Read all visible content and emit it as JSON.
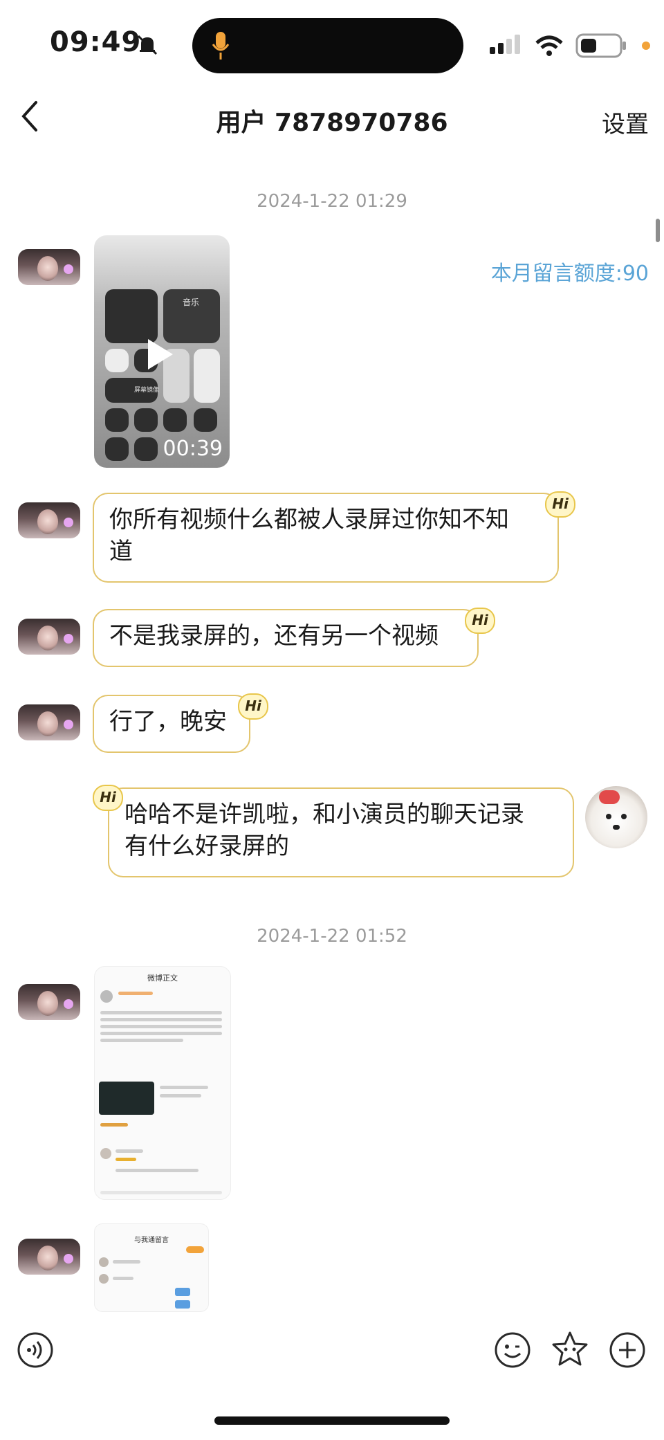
{
  "status": {
    "time": "09:49"
  },
  "nav": {
    "title": "用户 7878970786",
    "settings": "设置"
  },
  "timestamps": [
    "2024-1-22 01:29",
    "2024-1-22 01:52"
  ],
  "quota": "本月留言额度:90",
  "video": {
    "duration": "00:39",
    "tile_label": "音乐",
    "focus_label": "屏幕镜像"
  },
  "messages": [
    {
      "side": "left",
      "text_line1": "你所有视频什么都被人录屏过你知不知",
      "text_line2": "道"
    },
    {
      "side": "left",
      "text": "不是我录屏的，还有另一个视频"
    },
    {
      "side": "left",
      "text": "行了，晚安"
    },
    {
      "side": "right",
      "text_line1": "哈哈不是许凯啦，和小演员的聊天记录",
      "text_line2": "有什么好录屏的"
    }
  ],
  "badge": "Hi",
  "shot1": {
    "header": "微博正文"
  },
  "shot2": {
    "header": "与我通留言"
  },
  "colors": {
    "bubble_border": "#e3c56d",
    "quota": "#5aa4d6",
    "accent_dot": "#f2a33a"
  }
}
